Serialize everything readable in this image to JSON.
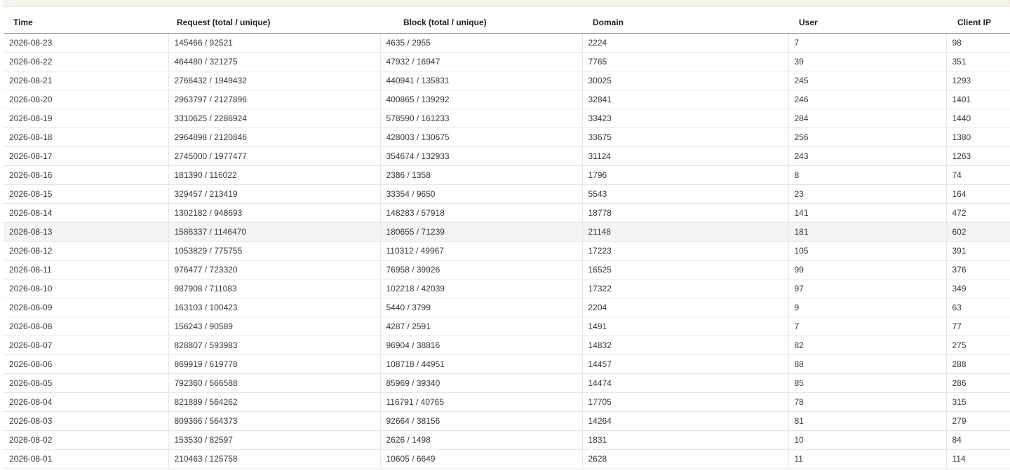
{
  "table": {
    "headers": [
      "Time",
      "Request (total / unique)",
      "Block (total / unique)",
      "Domain",
      "User",
      "Client IP"
    ],
    "rows": [
      [
        "2026-08-23",
        "145466 / 92521",
        "4635 / 2955",
        "2224",
        "7",
        "98"
      ],
      [
        "2026-08-22",
        "464480 / 321275",
        "47932 / 16947",
        "7765",
        "39",
        "351"
      ],
      [
        "2026-08-21",
        "2766432 / 1949432",
        "440941 / 135831",
        "30025",
        "245",
        "1293"
      ],
      [
        "2026-08-20",
        "2963797 / 2127896",
        "400865 / 139292",
        "32841",
        "246",
        "1401"
      ],
      [
        "2026-08-19",
        "3310625 / 2286924",
        "578590 / 161233",
        "33423",
        "284",
        "1440"
      ],
      [
        "2026-08-18",
        "2964898 / 2120846",
        "428003 / 130675",
        "33675",
        "256",
        "1380"
      ],
      [
        "2026-08-17",
        "2745000 / 1977477",
        "354674 / 132933",
        "31124",
        "243",
        "1263"
      ],
      [
        "2026-08-16",
        "181390 / 116022",
        "2386 / 1358",
        "1796",
        "8",
        "74"
      ],
      [
        "2026-08-15",
        "329457 / 213419",
        "33354 / 9650",
        "5543",
        "23",
        "164"
      ],
      [
        "2026-08-14",
        "1302182 / 948693",
        "148283 / 57918",
        "18778",
        "141",
        "472"
      ],
      [
        "2026-08-13",
        "1586337 / 1146470",
        "180655 / 71239",
        "21148",
        "181",
        "602"
      ],
      [
        "2026-08-12",
        "1053829 / 775755",
        "110312 / 49967",
        "17223",
        "105",
        "391"
      ],
      [
        "2026-08-11",
        "976477 / 723320",
        "76958 / 39926",
        "16525",
        "99",
        "376"
      ],
      [
        "2026-08-10",
        "987908 / 711083",
        "102218 / 42039",
        "17322",
        "97",
        "349"
      ],
      [
        "2026-08-09",
        "163103 / 100423",
        "5440 / 3799",
        "2204",
        "9",
        "63"
      ],
      [
        "2026-08-08",
        "156243 / 90589",
        "4287 / 2591",
        "1491",
        "7",
        "77"
      ],
      [
        "2026-08-07",
        "828807 / 593983",
        "96904 / 38816",
        "14832",
        "82",
        "275"
      ],
      [
        "2026-08-06",
        "869919 / 619778",
        "108718 / 44951",
        "14457",
        "88",
        "288"
      ],
      [
        "2026-08-05",
        "792360 / 566588",
        "85969 / 39340",
        "14474",
        "85",
        "286"
      ],
      [
        "2026-08-04",
        "821889 / 564262",
        "116791 / 40765",
        "17705",
        "78",
        "315"
      ],
      [
        "2026-08-03",
        "809366 / 564373",
        "92664 / 38156",
        "14264",
        "81",
        "279"
      ],
      [
        "2026-08-02",
        "153530 / 82597",
        "2626 / 1498",
        "1831",
        "10",
        "84"
      ],
      [
        "2026-08-01",
        "210463 / 125758",
        "10605 / 6649",
        "2628",
        "11",
        "114"
      ]
    ],
    "highlighted_row": 10
  }
}
